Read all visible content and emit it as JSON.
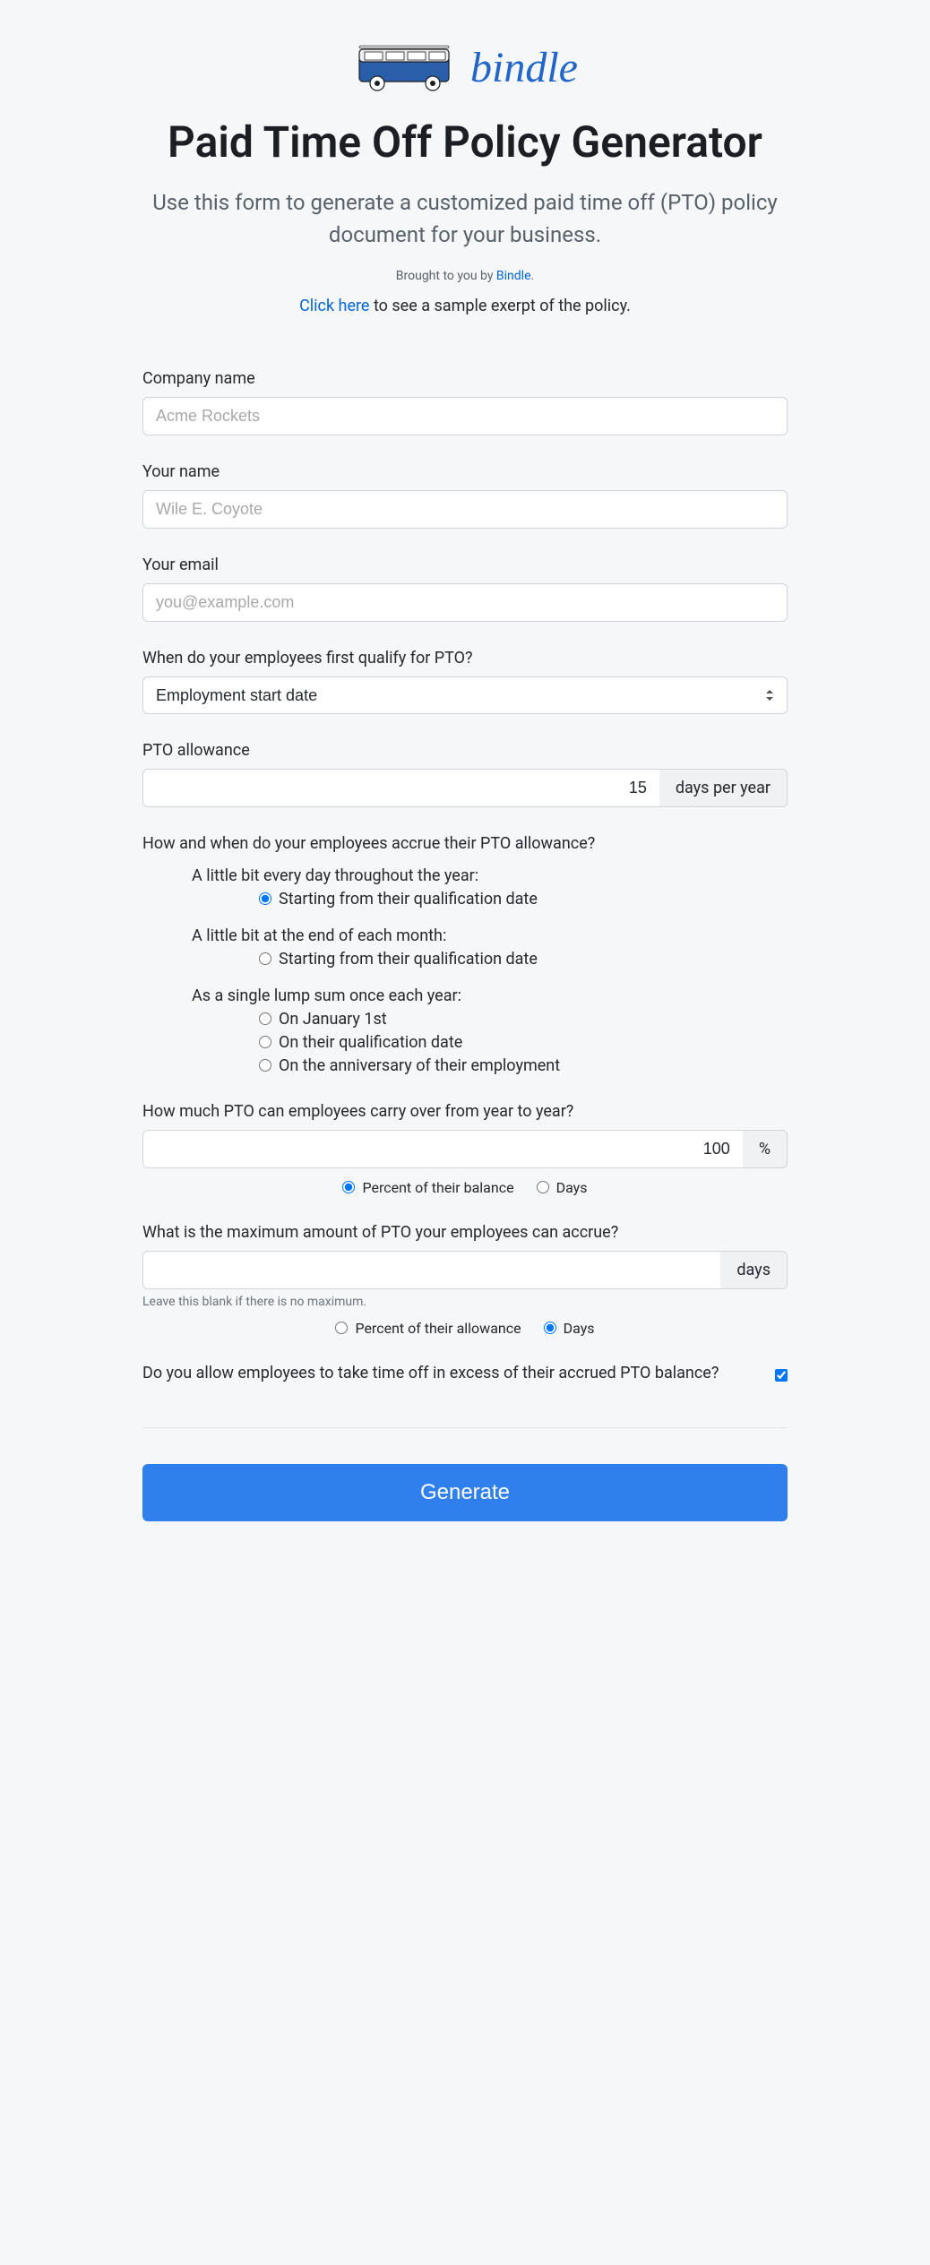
{
  "header": {
    "brand": "bindle",
    "title": "Paid Time Off Policy Generator",
    "subtitle": "Use this form to generate a customized paid time off (PTO) policy document for your business.",
    "brought_prefix": "Brought to you by ",
    "brought_link": "Bindle",
    "brought_suffix": ".",
    "sample_link": "Click here",
    "sample_suffix": " to see a sample exerpt of the policy."
  },
  "form": {
    "company_name": {
      "label": "Company name",
      "placeholder": "Acme Rockets",
      "value": ""
    },
    "your_name": {
      "label": "Your name",
      "placeholder": "Wile E. Coyote",
      "value": ""
    },
    "your_email": {
      "label": "Your email",
      "placeholder": "you@example.com",
      "value": ""
    },
    "qualify": {
      "label": "When do your employees first qualify for PTO?",
      "selected": "Employment start date"
    },
    "allowance": {
      "label": "PTO allowance",
      "value": "15",
      "unit": "days per year"
    },
    "accrue": {
      "label": "How and when do your employees accrue their PTO allowance?",
      "group1_heading": "A little bit every day throughout the year:",
      "group1_opt1": "Starting from their qualification date",
      "group2_heading": "A little bit at the end of each month:",
      "group2_opt1": "Starting from their qualification date",
      "group3_heading": "As a single lump sum once each year:",
      "group3_opt1": "On January 1st",
      "group3_opt2": "On their qualification date",
      "group3_opt3": "On the anniversary of their employment"
    },
    "carry_over": {
      "label": "How much PTO can employees carry over from year to year?",
      "value": "100",
      "unit": "%",
      "unit_opt1": "Percent of their balance",
      "unit_opt2": "Days"
    },
    "max_accrue": {
      "label": "What is the maximum amount of PTO your employees can accrue?",
      "value": "",
      "unit": "days",
      "help": "Leave this blank if there is no maximum.",
      "unit_opt1": "Percent of their allowance",
      "unit_opt2": "Days"
    },
    "excess": {
      "label": "Do you allow employees to take time off in excess of their accrued PTO balance?"
    },
    "submit": "Generate"
  }
}
